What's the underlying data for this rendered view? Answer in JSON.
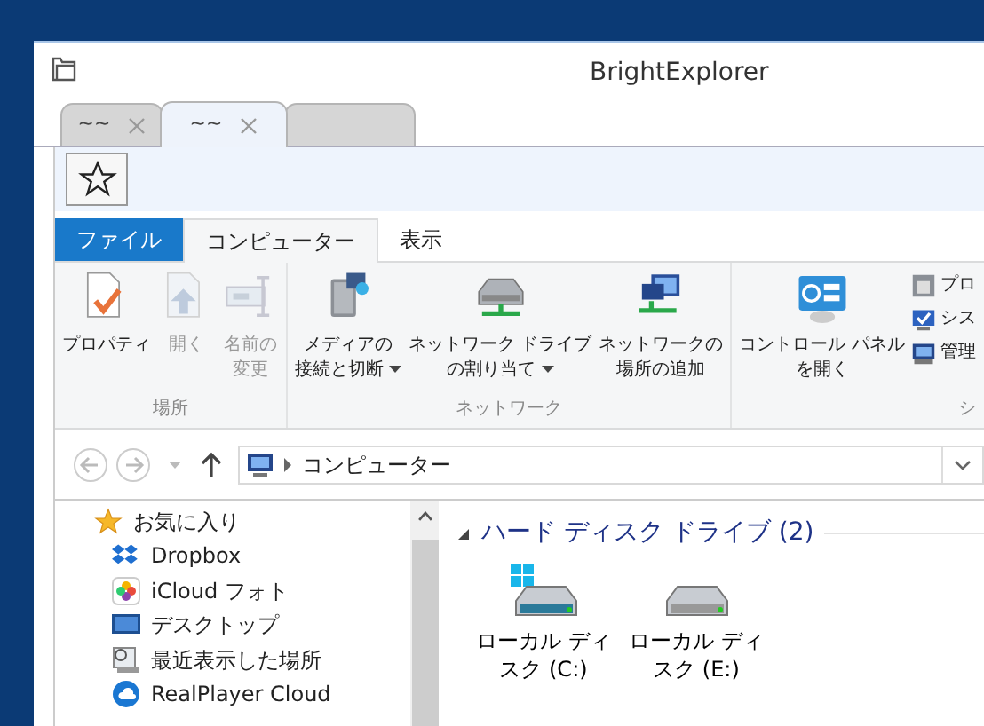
{
  "window": {
    "title": "BrightExplorer"
  },
  "tabs": [
    {
      "label": "~~",
      "selected": false,
      "closable": true
    },
    {
      "label": "~~",
      "selected": true,
      "closable": true
    },
    {
      "selected": false,
      "closable": false
    }
  ],
  "ribbon": {
    "tabs": [
      {
        "label": "ファイル",
        "kind": "file",
        "selected": false
      },
      {
        "label": "コンピューター",
        "kind": "tab",
        "selected": true
      },
      {
        "label": "表示",
        "kind": "tab",
        "selected": false
      }
    ],
    "groups": [
      {
        "label": "場所",
        "commands": [
          {
            "kind": "properties",
            "lines": [
              "プロパティ"
            ],
            "disabled": false,
            "dropdown": false
          },
          {
            "kind": "open",
            "lines": [
              "開く"
            ],
            "disabled": true,
            "dropdown": false
          },
          {
            "kind": "rename",
            "lines": [
              "名前の",
              "変更"
            ],
            "disabled": true,
            "dropdown": false
          }
        ]
      },
      {
        "label": "ネットワーク",
        "commands": [
          {
            "kind": "media",
            "lines": [
              "メディアの",
              "接続と切断"
            ],
            "disabled": false,
            "dropdown": true
          },
          {
            "kind": "drive",
            "lines": [
              "ネットワーク ドライブ",
              "の割り当て"
            ],
            "disabled": false,
            "dropdown": true
          },
          {
            "kind": "netplace",
            "lines": [
              "ネットワークの",
              "場所の追加"
            ],
            "disabled": false,
            "dropdown": false
          }
        ]
      },
      {
        "label": "シ",
        "commands": [
          {
            "kind": "control",
            "lines": [
              "コントロール パネル",
              "を開く"
            ],
            "disabled": false,
            "dropdown": false
          }
        ],
        "small_commands": [
          {
            "kind": "uninstall",
            "label": "プロ"
          },
          {
            "kind": "system",
            "label": "シス"
          },
          {
            "kind": "manage",
            "label": "管理"
          }
        ]
      }
    ]
  },
  "address_bar": {
    "back_disabled": true,
    "forward_disabled": true,
    "path": [
      "コンピューター"
    ]
  },
  "nav_pane": {
    "items": [
      {
        "label": "お気に入り",
        "kind": "favorites",
        "children": [
          {
            "label": "Dropbox",
            "kind": "dropbox"
          },
          {
            "label": "iCloud フォト",
            "kind": "photos"
          },
          {
            "label": "デスクトップ",
            "kind": "desktop"
          },
          {
            "label": "最近表示した場所",
            "kind": "recent"
          },
          {
            "label": "RealPlayer Cloud",
            "kind": "cloud"
          }
        ]
      }
    ]
  },
  "content": {
    "groups": [
      {
        "title": "ハード ディスク ドライブ (2)",
        "expanded": true,
        "items": [
          {
            "label": "ローカル ディスク (C:)",
            "kind": "system"
          },
          {
            "label": "ローカル ディスク (E:)",
            "kind": "data"
          }
        ]
      }
    ]
  }
}
